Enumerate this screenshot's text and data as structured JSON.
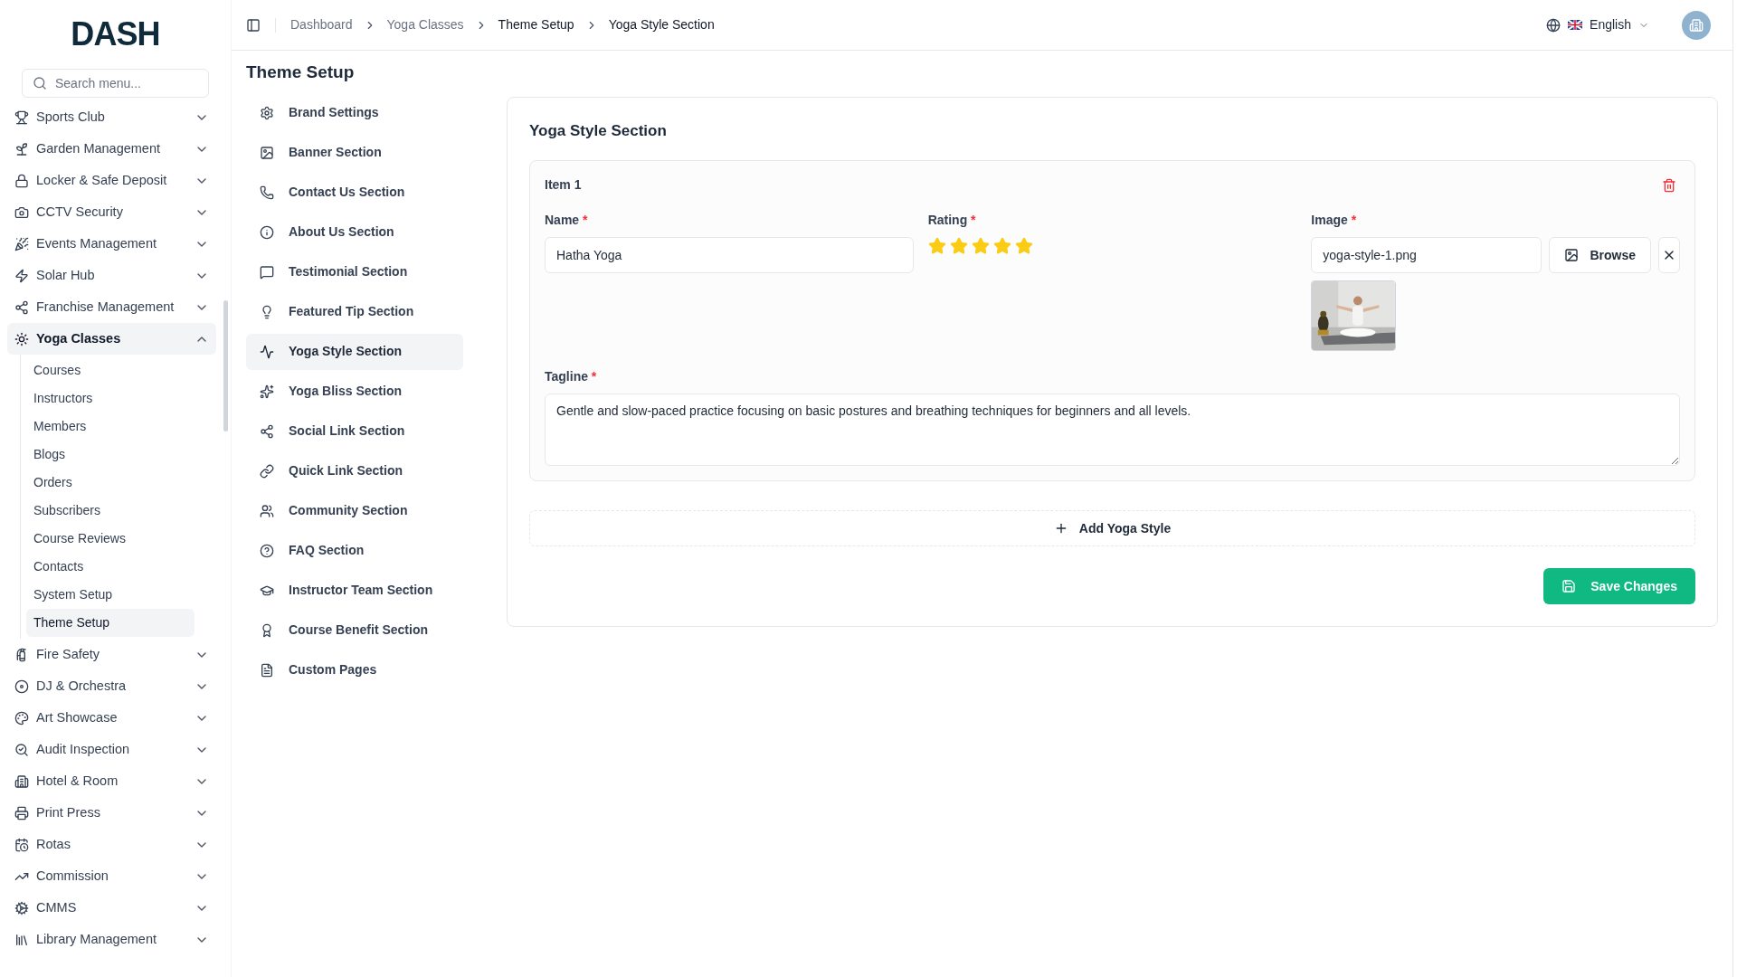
{
  "logo": "DASH",
  "search": {
    "placeholder": "Search menu..."
  },
  "sidebar": {
    "items": [
      {
        "label": "Sports Club",
        "expanded": false
      },
      {
        "label": "Garden Management",
        "expanded": false
      },
      {
        "label": "Locker & Safe Deposit",
        "expanded": false
      },
      {
        "label": "CCTV Security",
        "expanded": false
      },
      {
        "label": "Events Management",
        "expanded": false
      },
      {
        "label": "Solar Hub",
        "expanded": false
      },
      {
        "label": "Franchise Management",
        "expanded": false
      },
      {
        "label": "Yoga Classes",
        "expanded": true,
        "children": [
          {
            "label": "Courses",
            "selected": false
          },
          {
            "label": "Instructors",
            "selected": false
          },
          {
            "label": "Members",
            "selected": false
          },
          {
            "label": "Blogs",
            "selected": false
          },
          {
            "label": "Orders",
            "selected": false
          },
          {
            "label": "Subscribers",
            "selected": false
          },
          {
            "label": "Course Reviews",
            "selected": false
          },
          {
            "label": "Contacts",
            "selected": false
          },
          {
            "label": "System Setup",
            "selected": false
          },
          {
            "label": "Theme Setup",
            "selected": true
          }
        ]
      },
      {
        "label": "Fire Safety",
        "expanded": false
      },
      {
        "label": "DJ & Orchestra",
        "expanded": false
      },
      {
        "label": "Art Showcase",
        "expanded": false
      },
      {
        "label": "Audit Inspection",
        "expanded": false
      },
      {
        "label": "Hotel & Room",
        "expanded": false
      },
      {
        "label": "Print Press",
        "expanded": false
      },
      {
        "label": "Rotas",
        "expanded": false
      },
      {
        "label": "Commission",
        "expanded": false
      },
      {
        "label": "CMMS",
        "expanded": false
      },
      {
        "label": "Library Management",
        "expanded": false
      }
    ]
  },
  "breadcrumbs": [
    "Dashboard",
    "Yoga Classes",
    "Theme Setup",
    "Yoga Style Section"
  ],
  "language": "English",
  "page_title": "Theme Setup",
  "theme_menu": [
    {
      "label": "Brand Settings",
      "selected": false
    },
    {
      "label": "Banner Section",
      "selected": false
    },
    {
      "label": "Contact Us Section",
      "selected": false
    },
    {
      "label": "About Us Section",
      "selected": false
    },
    {
      "label": "Testimonial Section",
      "selected": false
    },
    {
      "label": "Featured Tip Section",
      "selected": false
    },
    {
      "label": "Yoga Style Section",
      "selected": true
    },
    {
      "label": "Yoga Bliss Section",
      "selected": false
    },
    {
      "label": "Social Link Section",
      "selected": false
    },
    {
      "label": "Quick Link Section",
      "selected": false
    },
    {
      "label": "Community Section",
      "selected": false
    },
    {
      "label": "FAQ Section",
      "selected": false
    },
    {
      "label": "Instructor Team Section",
      "selected": false
    },
    {
      "label": "Course Benefit Section",
      "selected": false
    },
    {
      "label": "Custom Pages",
      "selected": false
    }
  ],
  "section": {
    "title": "Yoga Style Section",
    "items": [
      {
        "title": "Item 1",
        "name_label": "Name",
        "name_required": "*",
        "name": "Hatha Yoga",
        "rating_label": "Rating",
        "rating_required": "*",
        "stars": 5,
        "image_label": "Image",
        "image_required": "*",
        "image_file": "yoga-style-1.png",
        "browse": "Browse",
        "tagline_label": "Tagline",
        "tagline_required": "*",
        "tagline": "Gentle and slow-paced practice focusing on basic postures and breathing techniques for beginners and all levels."
      }
    ],
    "add_button": "Add Yoga Style",
    "save_button": "Save Changes"
  }
}
